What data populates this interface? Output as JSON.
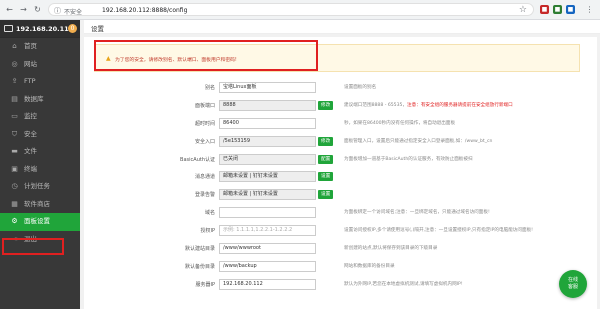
{
  "browser": {
    "insecure_label": "不安全",
    "url": "192.168.20.112:8888/config"
  },
  "sidebar": {
    "host_ip": "192.168.20.112",
    "badge": "0",
    "items": [
      {
        "icon": "home-icon",
        "glyph": "⌂",
        "label": "首页"
      },
      {
        "icon": "globe-icon",
        "glyph": "◎",
        "label": "网站"
      },
      {
        "icon": "upload-icon",
        "glyph": "⇪",
        "label": "FTP"
      },
      {
        "icon": "database-icon",
        "glyph": "▤",
        "label": "数据库"
      },
      {
        "icon": "monitor-icon",
        "glyph": "▭",
        "label": "监控"
      },
      {
        "icon": "shield-icon",
        "glyph": "⛉",
        "label": "安全"
      },
      {
        "icon": "folder-icon",
        "glyph": "▬",
        "label": "文件"
      },
      {
        "icon": "terminal-icon",
        "glyph": "▣",
        "label": "终端"
      },
      {
        "icon": "clock-icon",
        "glyph": "◷",
        "label": "计划任务"
      },
      {
        "icon": "store-icon",
        "glyph": "▦",
        "label": "软件商店"
      },
      {
        "icon": "gear-icon",
        "glyph": "⚙",
        "label": "面板设置",
        "active": true
      },
      {
        "icon": "logout-icon",
        "glyph": "⇥",
        "label": "退出"
      }
    ]
  },
  "main": {
    "title": "设置",
    "alert": "为了您的安全，请修改别名、默认端口、面板用户和密码!",
    "rows": [
      {
        "label": "别名",
        "value": "宝塔Linux面板",
        "tip": "设置面板的别名"
      },
      {
        "label": "面板端口",
        "value": "8888",
        "button": "修改",
        "tip": "建议端口范围8888 - 65535，",
        "tip_red": "注意：有安全组的服务器请提前在安全组放行新端口"
      },
      {
        "label": "超时时间",
        "value": "86400",
        "tip": "秒，如果在86400秒内没有任何操作，将自动退出面板"
      },
      {
        "label": "安全入口",
        "value": "/5e153159",
        "button": "修改",
        "tip": "面板管理入口，设置后只能通过指定安全入口登录面板,如：/www_bt_cn"
      },
      {
        "label": "BasicAuth认证",
        "value": "已关闭",
        "button": "配置",
        "tip": "为面板增加一道基于BasicAuth的认证服务，有效防止面板被扫"
      },
      {
        "label": "消息通道",
        "value": "邮箱未设置 | 钉钉未设置",
        "button": "设置",
        "tip": ""
      },
      {
        "label": "登录告警",
        "value": "邮箱未设置 | 钉钉未设置",
        "button": "设置",
        "tip": ""
      },
      {
        "label": "域名",
        "value": "",
        "tip": "为面板绑定一个访问域名;注意：一旦绑定域名，只能通过域名访问面板!"
      },
      {
        "label": "授权IP",
        "placeholder": "示例: 1.1.1.1,1.2.2.1-1.2.2.2",
        "tip": "设置访问授权IP,多个请使用逗号(,)隔开,注意：一旦设置授权IP,只有指定IP的电脑能访问面板!"
      },
      {
        "label": "默认建站目录",
        "value": "/www/wwwroot",
        "tip": "新创建的站点,默认将保存到该目录的下级目录"
      },
      {
        "label": "默认备份目录",
        "value": "/www/backup",
        "tip": "网站和数据库的备份目录"
      },
      {
        "label": "服务器IP",
        "value": "192.168.20.112",
        "tip": "默认为外网IP,若您在本地虚拟机测试,请填写虚拟机内网IP!"
      }
    ]
  },
  "fab": {
    "line1": "在线",
    "line2": "客服"
  },
  "colors": {
    "accent": "#20a53a",
    "sidebar": "#383838",
    "alert_outline": "#e02020"
  }
}
